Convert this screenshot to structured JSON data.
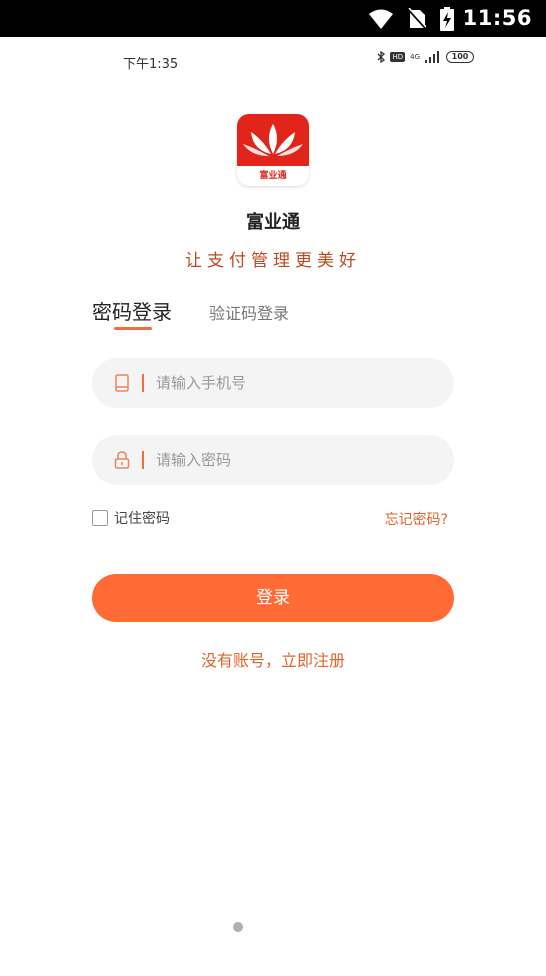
{
  "system_bar": {
    "time": "11:56"
  },
  "inner_status": {
    "time": "下午1:35",
    "hd": "HD",
    "network": "4G",
    "battery": "100"
  },
  "logo": {
    "text": "富业通"
  },
  "app": {
    "name": "富业通",
    "slogan": "让支付管理更美好"
  },
  "tabs": [
    {
      "label": "密码登录",
      "active": true
    },
    {
      "label": "验证码登录",
      "active": false
    }
  ],
  "form": {
    "phone": {
      "placeholder": "请输入手机号",
      "value": ""
    },
    "password": {
      "placeholder": "请输入密码",
      "value": ""
    },
    "remember_label": "记住密码",
    "remember_checked": false,
    "forgot_label": "忘记密码?"
  },
  "login_button": {
    "label": "登录"
  },
  "register_link": {
    "label": "没有账号，立即注册"
  },
  "colors": {
    "accent": "#ff6a35",
    "brand_red": "#e1251b",
    "slogan": "#c2471f",
    "link": "#e0642c"
  },
  "icons": [
    "wifi-icon",
    "no-sim-icon",
    "battery-charging-icon",
    "bluetooth-icon",
    "signal-icon",
    "phone-icon",
    "lock-icon"
  ]
}
